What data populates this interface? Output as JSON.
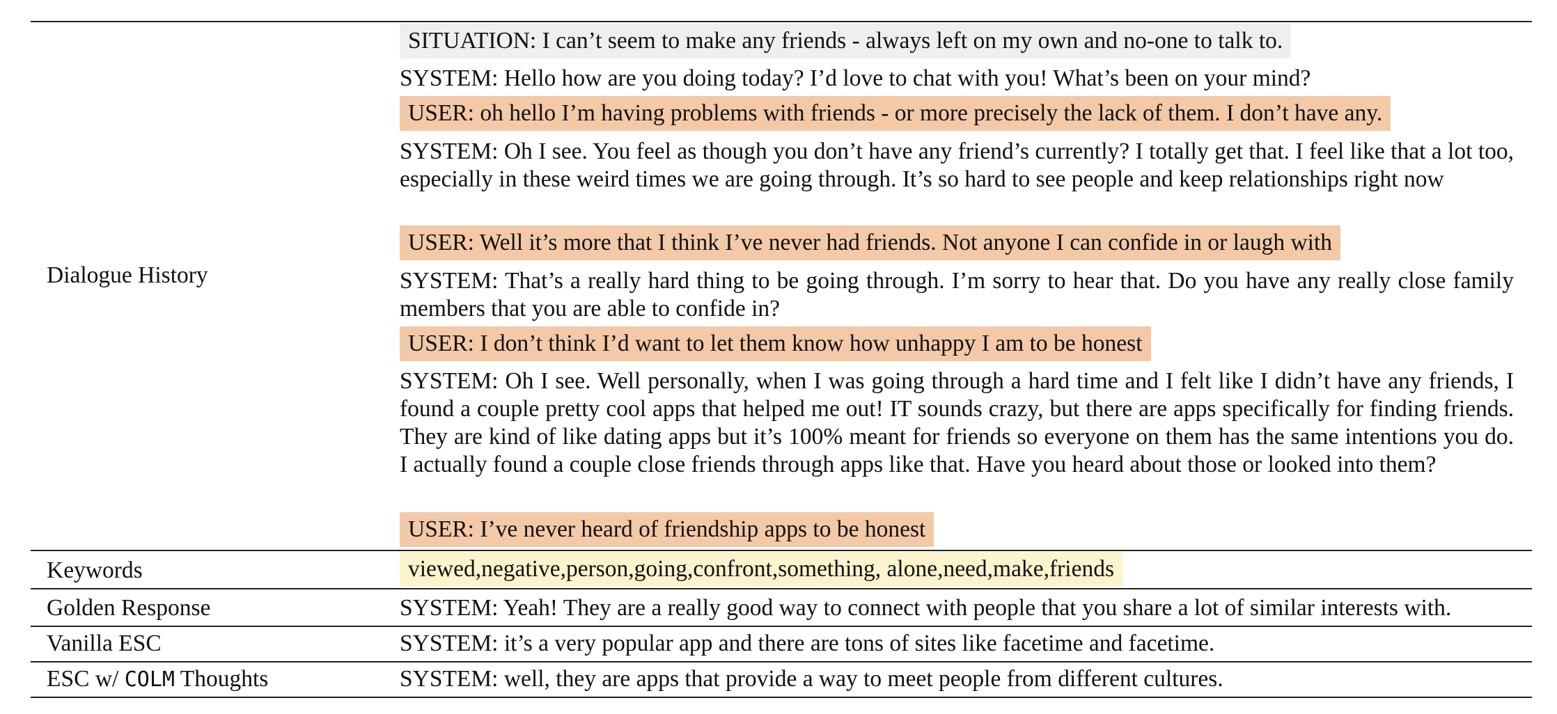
{
  "labels": {
    "dialogue_history": "Dialogue History",
    "keywords": "Keywords",
    "golden_response": "Golden Response",
    "vanilla_esc": "Vanilla ESC",
    "esc_colm_prefix": "ESC w/",
    "esc_colm_mono": "COLM",
    "esc_colm_suffix": "Thoughts"
  },
  "dialogue": {
    "situation": "SITUATION: I can’t seem to make any friends - always left on my own and no-one to talk to.",
    "system_1": "SYSTEM: Hello how are you doing today? I’d love to chat with you! What’s been on your mind?",
    "user_1": "USER: oh hello I’m having problems with friends - or more precisely the lack of them. I don’t have any.",
    "system_2": "SYSTEM: Oh I see. You feel as though you don’t have any friend’s currently? I totally get that. I feel like that a lot too, especially in these weird times we are going through. It’s so hard to see people and keep relationships right now",
    "user_2": "USER: Well it’s more that I think I’ve never had friends. Not anyone I can confide in or laugh with",
    "system_3": "SYSTEM: That’s a really hard thing to be going through. I’m sorry to hear that. Do you have any really close family members that you are able to confide in?",
    "user_3": "USER: I don’t think I’d want to let them know how unhappy I am to be honest",
    "system_4": "SYSTEM: Oh I see. Well personally, when I was going through a hard time and I felt like I didn’t have any friends, I found a couple pretty cool apps that helped me out! IT sounds crazy, but there are apps specifically for finding friends. They are kind of like dating apps but it’s 100% meant for friends so everyone on them has the same intentions you do. I actually found a couple close friends through apps like that. Have you heard about those or looked into them?",
    "user_4": "USER: I’ve never heard of friendship apps to be honest"
  },
  "keywords_text": "viewed,negative,person,going,confront,something, alone,need,make,friends",
  "golden_response_text": "SYSTEM: Yeah! They are a really good way to connect with people that you share a lot of similar interests with.",
  "vanilla_esc_text": "SYSTEM: it’s a very popular app and there are tons of sites like facetime and facetime.",
  "esc_colm_text": "SYSTEM: well, they are apps that provide a way to meet people from different cultures.",
  "colors": {
    "situation_bg": "#efefef",
    "user_bg": "#f3c9a7",
    "keywords_bg": "#fdf3cc"
  }
}
